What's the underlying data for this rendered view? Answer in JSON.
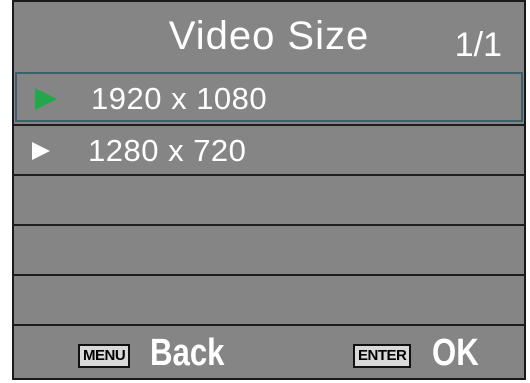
{
  "menu": {
    "title": "Video Size",
    "page_indicator": "1/1",
    "items": [
      {
        "label": "1920 x 1080",
        "selected": true
      },
      {
        "label": "1280 x 720",
        "selected": false
      },
      {
        "label": ""
      },
      {
        "label": ""
      },
      {
        "label": ""
      }
    ]
  },
  "footer": {
    "back_key": "MENU",
    "back_label": "Back",
    "ok_key": "ENTER",
    "ok_label": "OK"
  },
  "colors": {
    "background": "#858585",
    "selected_arrow": "#22a84a",
    "text": "#ffffff"
  }
}
